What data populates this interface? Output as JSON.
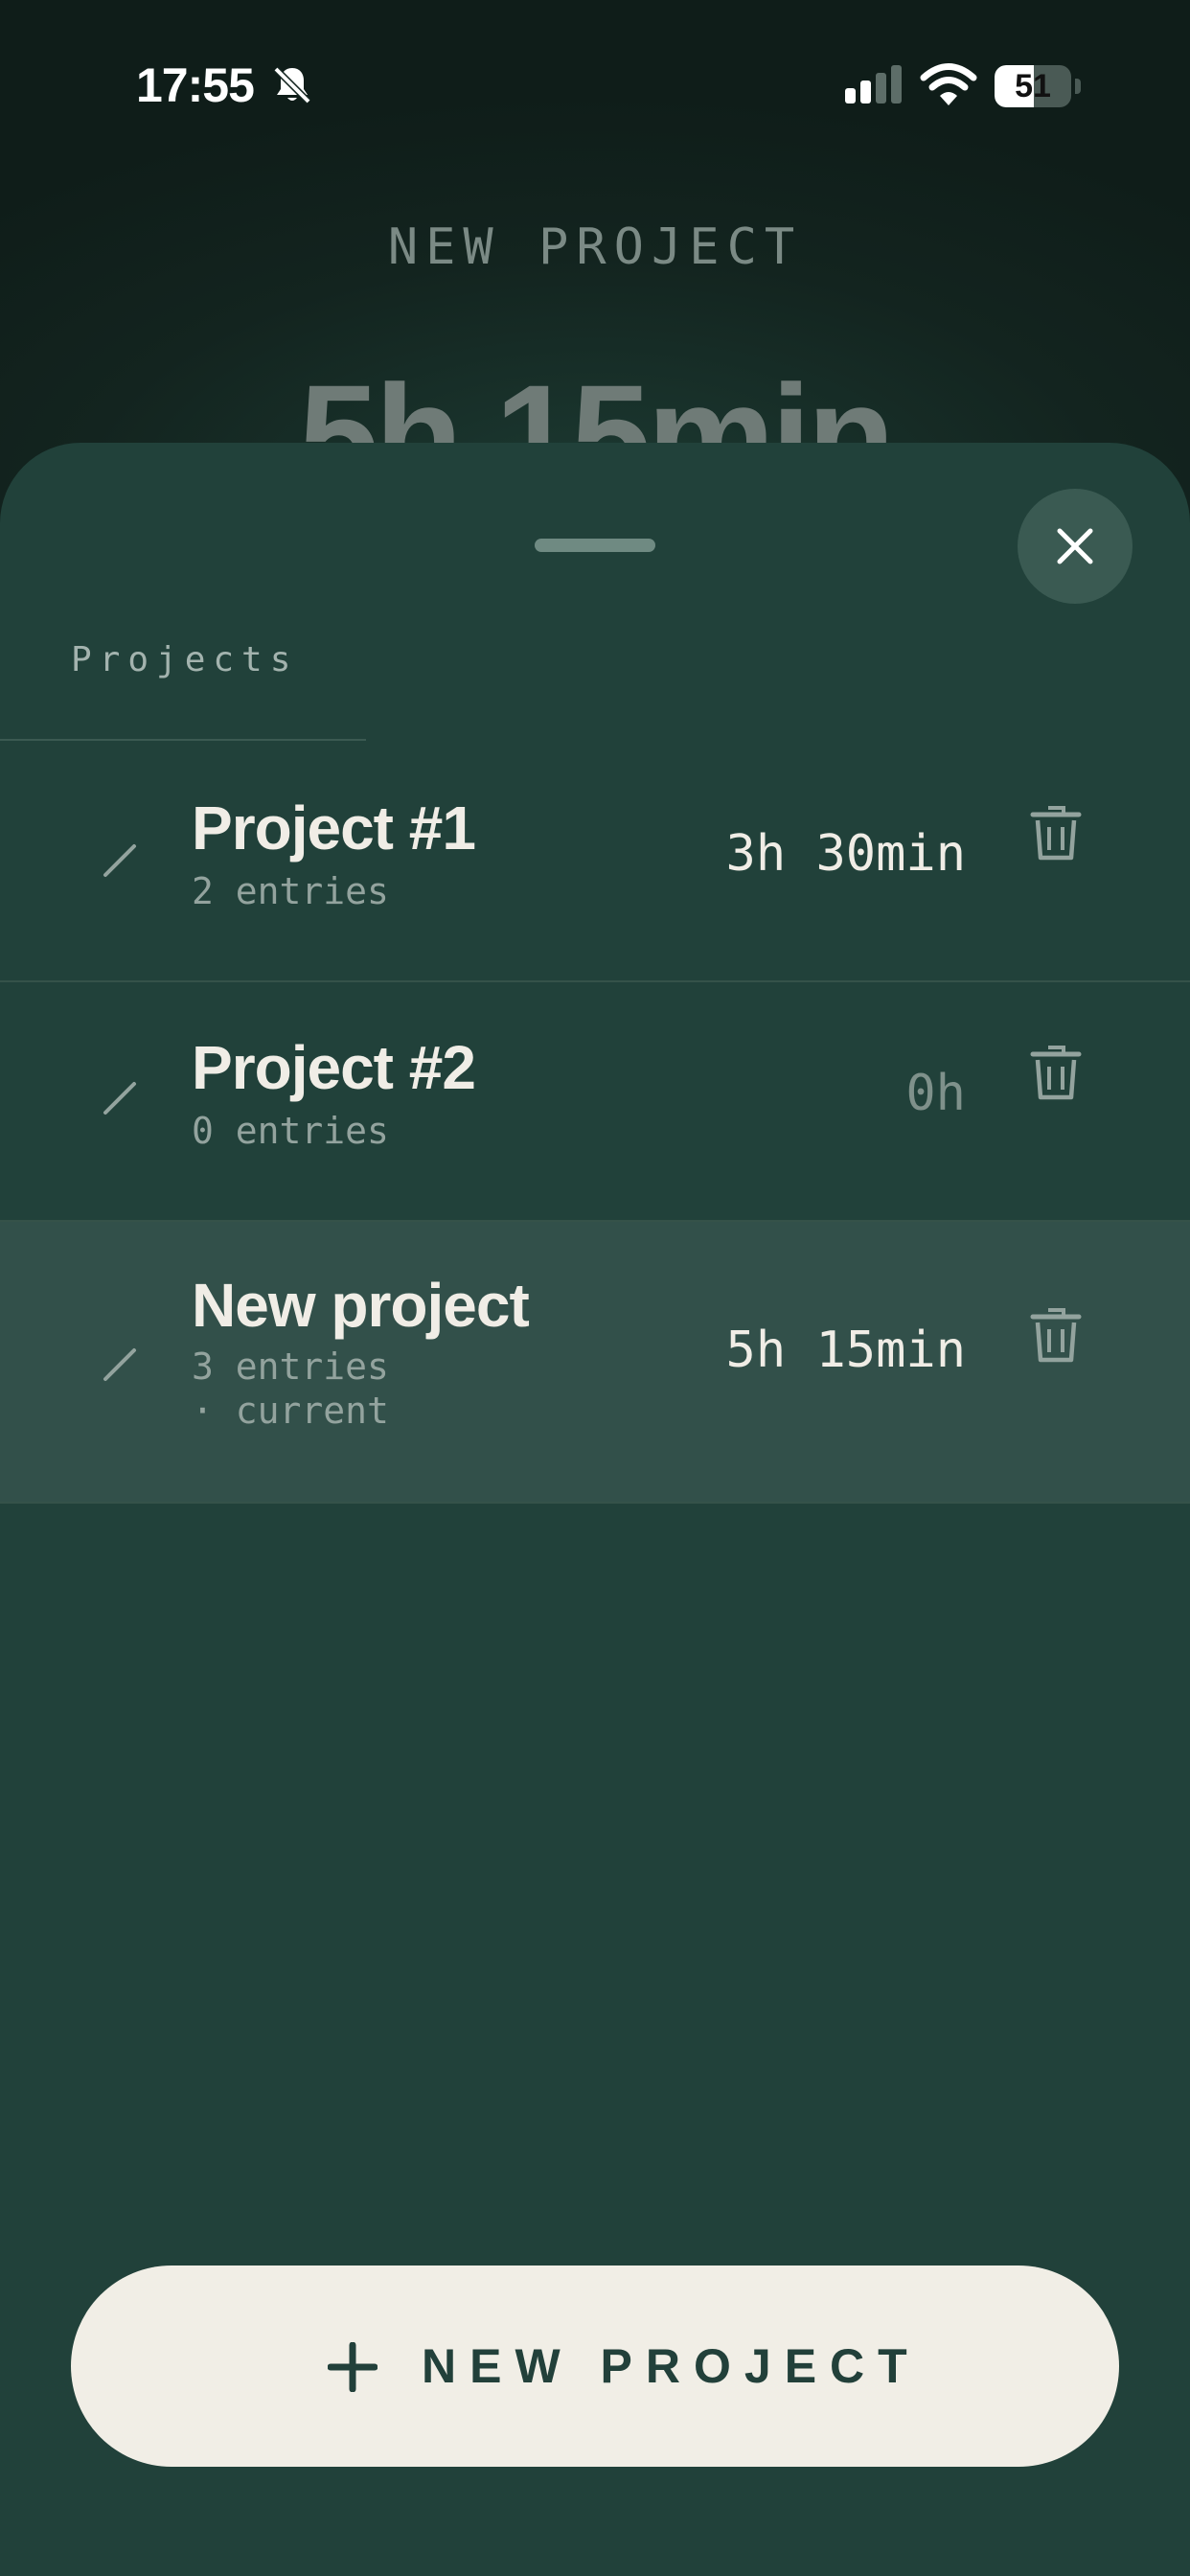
{
  "status_bar": {
    "time": "17:55",
    "battery_level": "51",
    "battery_fraction": 0.51,
    "icons": [
      "bell-slash-icon",
      "signal-icon",
      "wifi-icon",
      "battery-icon"
    ]
  },
  "background": {
    "title": "NEW PROJECT",
    "timer": "5h 15min"
  },
  "sheet": {
    "section_label": "Projects",
    "close_icon": "close-icon",
    "projects": [
      {
        "name": "Project #1",
        "entries": "2 entries",
        "status": "",
        "duration": "3h 30min",
        "is_current": false
      },
      {
        "name": "Project #2",
        "entries": "0 entries",
        "status": "",
        "duration": "0h",
        "is_current": false
      },
      {
        "name": "New project",
        "entries": "3 entries",
        "status": "· current",
        "duration": "5h 15min",
        "is_current": true
      }
    ],
    "new_project_button": {
      "label": "NEW PROJECT",
      "icon": "plus-icon"
    }
  },
  "colors": {
    "sheet_background": "#21413a",
    "current_row_background": "#32504a",
    "button_background": "#f1eee6",
    "button_text": "#22403a",
    "primary_text": "#f0ede6",
    "secondary_text": "#93a39e"
  }
}
